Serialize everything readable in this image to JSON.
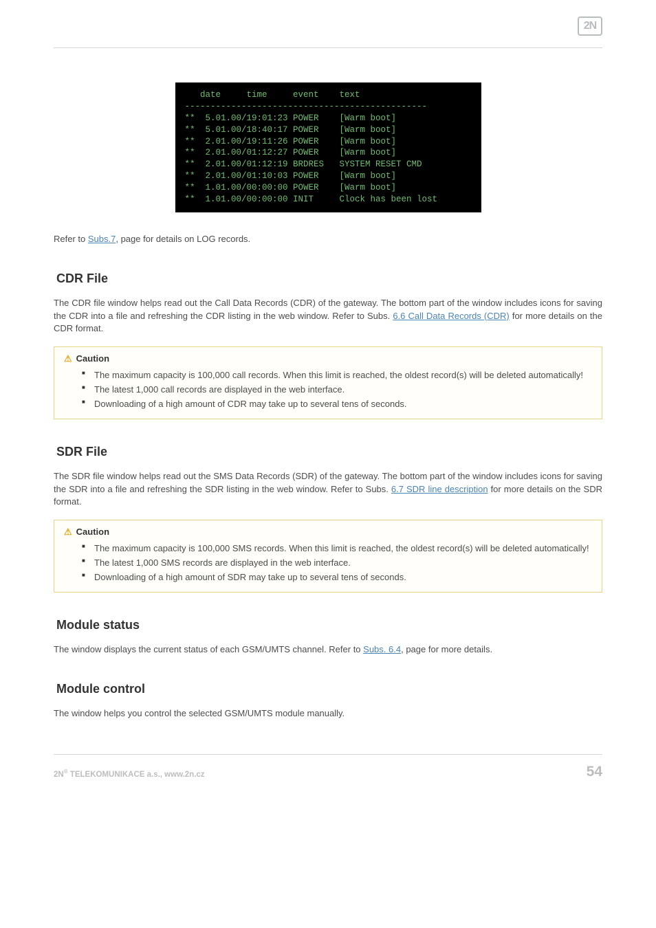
{
  "header": {
    "logo_text": "2N"
  },
  "terminal_text": "   date     time     event    text\n-----------------------------------------------\n**  5.01.00/19:01:23 POWER    [Warm boot]\n**  5.01.00/18:40:17 POWER    [Warm boot]\n**  2.01.00/19:11:26 POWER    [Warm boot]\n**  2.01.00/01:12:27 POWER    [Warm boot]\n**  2.01.00/01:12:19 BRDRES   SYSTEM RESET CMD\n**  2.01.00/01:10:03 POWER    [Warm boot]\n**  1.01.00/00:00:00 POWER    [Warm boot]\n**  1.01.00/00:00:00 INIT     Clock has been lost",
  "intro": {
    "pre": "Refer to ",
    "link": "Subs.7",
    "post": ", page for details on LOG records."
  },
  "sections": {
    "cdr": {
      "title": "CDR File",
      "para_pre": "The CDR file window helps read out the Call Data Records (CDR) of the gateway. The bottom part of the window includes icons for saving the CDR into a file and refreshing the CDR listing in the web window. Refer to Subs. ",
      "para_link": "6.6 Call Data Records (CDR)",
      "para_post": " for more details on the CDR format.",
      "caution_title": "Caution",
      "caution_items": [
        "The maximum capacity is 100,000 call records. When this limit is reached, the oldest record(s) will be deleted automatically!",
        "The latest 1,000 call records are displayed in the web interface.",
        "Downloading of a high amount of CDR may take up to several tens of seconds."
      ]
    },
    "sdr": {
      "title": "SDR File",
      "para_pre": "The SDR file window helps read out the SMS Data Records (SDR) of the gateway. The bottom part of the window includes icons for saving the SDR into a file and refreshing the SDR listing in the web window. Refer to Subs. ",
      "para_link": "6.7 SDR line description",
      "para_post": " for more details on the SDR format.",
      "caution_title": "Caution",
      "caution_items": [
        "The maximum capacity is 100,000 SMS records. When this limit is reached, the oldest record(s) will be deleted automatically!",
        "The latest 1,000 SMS records are displayed in the web interface.",
        "Downloading of a high amount of SDR may take up to several tens of seconds."
      ]
    },
    "module_status": {
      "title": "Module status",
      "para_pre": "The window displays the current status of each GSM/UMTS channel. Refer to ",
      "para_link": "Subs. 6.4",
      "para_post": ", page for more details."
    },
    "module_control": {
      "title": "Module control",
      "para": "The window helps you control the selected GSM/UMTS module manually."
    }
  },
  "footer": {
    "company_pre": "2N",
    "company_sup": "®",
    "company_post": " TELEKOMUNIKACE a.s., www.2n.cz",
    "page_number": "54"
  }
}
